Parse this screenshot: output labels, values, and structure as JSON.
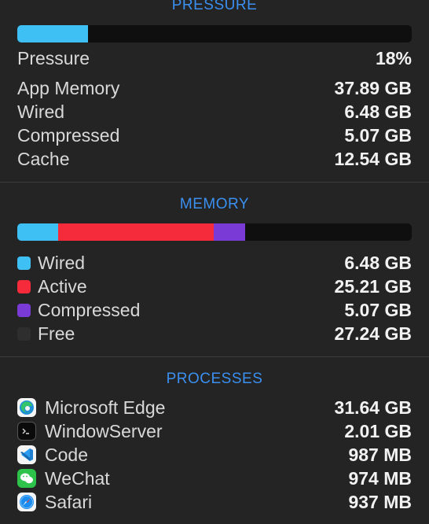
{
  "pressure": {
    "title": "PRESSURE",
    "bar_fraction": 0.18,
    "bar_color": "#3fc0f5",
    "rows": [
      {
        "label": "Pressure",
        "value": "18%"
      },
      {
        "label": "App Memory",
        "value": "37.89 GB"
      },
      {
        "label": "Wired",
        "value": "6.48 GB"
      },
      {
        "label": "Compressed",
        "value": "5.07 GB"
      },
      {
        "label": "Cache",
        "value": "12.54 GB"
      }
    ]
  },
  "memory": {
    "title": "MEMORY",
    "segments": [
      {
        "name": "Wired",
        "fraction": 0.104,
        "color": "#3fc0f5"
      },
      {
        "name": "Active",
        "fraction": 0.394,
        "color": "#f52a3a"
      },
      {
        "name": "Compressed",
        "fraction": 0.08,
        "color": "#7a3ad6"
      }
    ],
    "rows": [
      {
        "label": "Wired",
        "value": "6.48 GB",
        "color": "#3fc0f5"
      },
      {
        "label": "Active",
        "value": "25.21 GB",
        "color": "#f52a3a"
      },
      {
        "label": "Compressed",
        "value": "5.07 GB",
        "color": "#7a3ad6"
      },
      {
        "label": "Free",
        "value": "27.24 GB",
        "color": "#2e2e2e"
      }
    ]
  },
  "processes": {
    "title": "PROCESSES",
    "rows": [
      {
        "label": "Microsoft Edge",
        "value": "31.64 GB",
        "icon": "edge-icon"
      },
      {
        "label": "WindowServer",
        "value": "2.01 GB",
        "icon": "terminal-icon"
      },
      {
        "label": "Code",
        "value": "987 MB",
        "icon": "vscode-icon"
      },
      {
        "label": "WeChat",
        "value": "974 MB",
        "icon": "wechat-icon"
      },
      {
        "label": "Safari",
        "value": "937 MB",
        "icon": "safari-icon"
      }
    ]
  }
}
